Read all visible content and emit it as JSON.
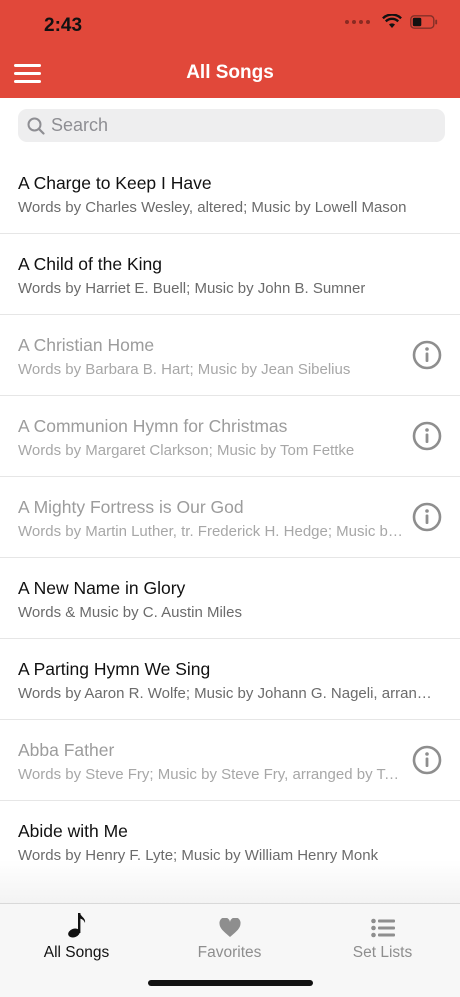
{
  "status_bar": {
    "time": "2:43"
  },
  "nav": {
    "title": "All Songs",
    "menu_icon": "hamburger-icon"
  },
  "search": {
    "placeholder": "Search"
  },
  "songs": [
    {
      "title": "A Charge to Keep I Have",
      "credits": "Words by Charles Wesley, altered; Music by Lowell Mason",
      "available": true
    },
    {
      "title": "A Child of the King",
      "credits": "Words by Harriet E. Buell; Music by John B. Sumner",
      "available": true
    },
    {
      "title": "A Christian Home",
      "credits": "Words by Barbara B. Hart; Music by Jean Sibelius",
      "available": false
    },
    {
      "title": "A Communion Hymn for Christmas",
      "credits": "Words by Margaret Clarkson; Music by Tom Fettke",
      "available": false
    },
    {
      "title": "A Mighty Fortress is Our God",
      "credits": "Words by Martin Luther, tr. Frederick H. Hedge; Music by Martin Luther",
      "available": false
    },
    {
      "title": "A New Name in Glory",
      "credits": "Words & Music by C. Austin Miles",
      "available": true
    },
    {
      "title": "A Parting Hymn We Sing",
      "credits": "Words by Aaron R. Wolfe; Music by Johann G. Nageli, arranged by Lowell Mason",
      "available": true
    },
    {
      "title": "Abba Father",
      "credits": "Words by Steve Fry; Music by Steve Fry, arranged by Tom Fettke",
      "available": false
    },
    {
      "title": "Abide with Me",
      "credits": "Words by Henry F. Lyte; Music by William Henry Monk",
      "available": true
    }
  ],
  "tabs": [
    {
      "label": "All Songs",
      "icon": "music-note-icon",
      "active": true
    },
    {
      "label": "Favorites",
      "icon": "heart-icon",
      "active": false
    },
    {
      "label": "Set Lists",
      "icon": "list-icon",
      "active": false
    }
  ],
  "colors": {
    "accent": "#e1483a",
    "dimmed_text": "#9c9c9c"
  }
}
